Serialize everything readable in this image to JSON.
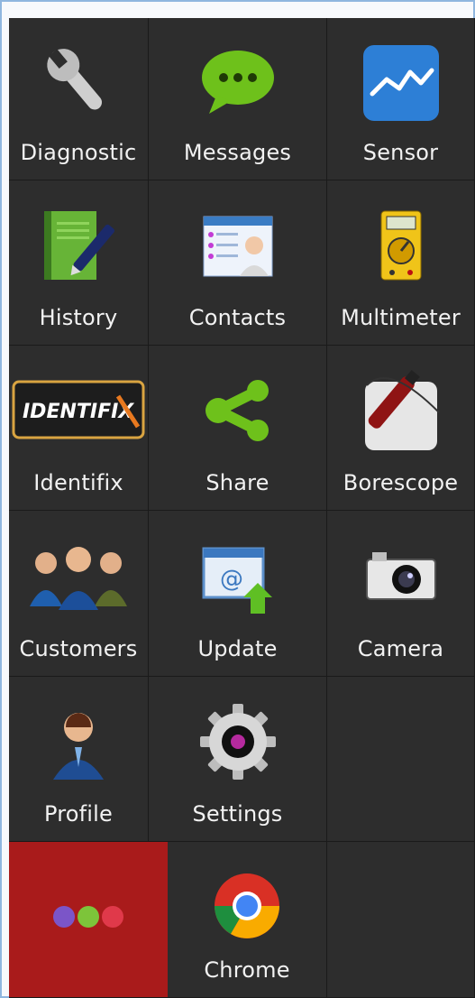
{
  "apps": [
    {
      "label": "Diagnostic",
      "icon": "wrench-icon"
    },
    {
      "label": "Messages",
      "icon": "chat-bubble-icon"
    },
    {
      "label": "Sensor",
      "icon": "line-graph-icon"
    },
    {
      "label": "History",
      "icon": "notebook-pen-icon"
    },
    {
      "label": "Contacts",
      "icon": "contacts-card-icon"
    },
    {
      "label": "Multimeter",
      "icon": "multimeter-icon"
    },
    {
      "label": "Identifix",
      "icon": "identifix-logo-icon",
      "logo_text": "IDENTIFIX"
    },
    {
      "label": "Share",
      "icon": "share-icon"
    },
    {
      "label": "Borescope",
      "icon": "borescope-icon"
    },
    {
      "label": "Customers",
      "icon": "people-group-icon"
    },
    {
      "label": "Update",
      "icon": "email-update-icon"
    },
    {
      "label": "Camera",
      "icon": "camera-icon"
    },
    {
      "label": "Profile",
      "icon": "person-profile-icon"
    },
    {
      "label": "Settings",
      "icon": "gear-icon"
    },
    {
      "label": "",
      "icon": "empty"
    },
    {
      "label": "",
      "icon": "more-dots-icon"
    },
    {
      "label": "Chrome",
      "icon": "chrome-icon"
    },
    {
      "label": "",
      "icon": "empty"
    }
  ],
  "colors": {
    "tile_bg": "#2d2d2d",
    "more_tile_bg": "#a91b1b",
    "label_color": "#f2f2f2"
  }
}
